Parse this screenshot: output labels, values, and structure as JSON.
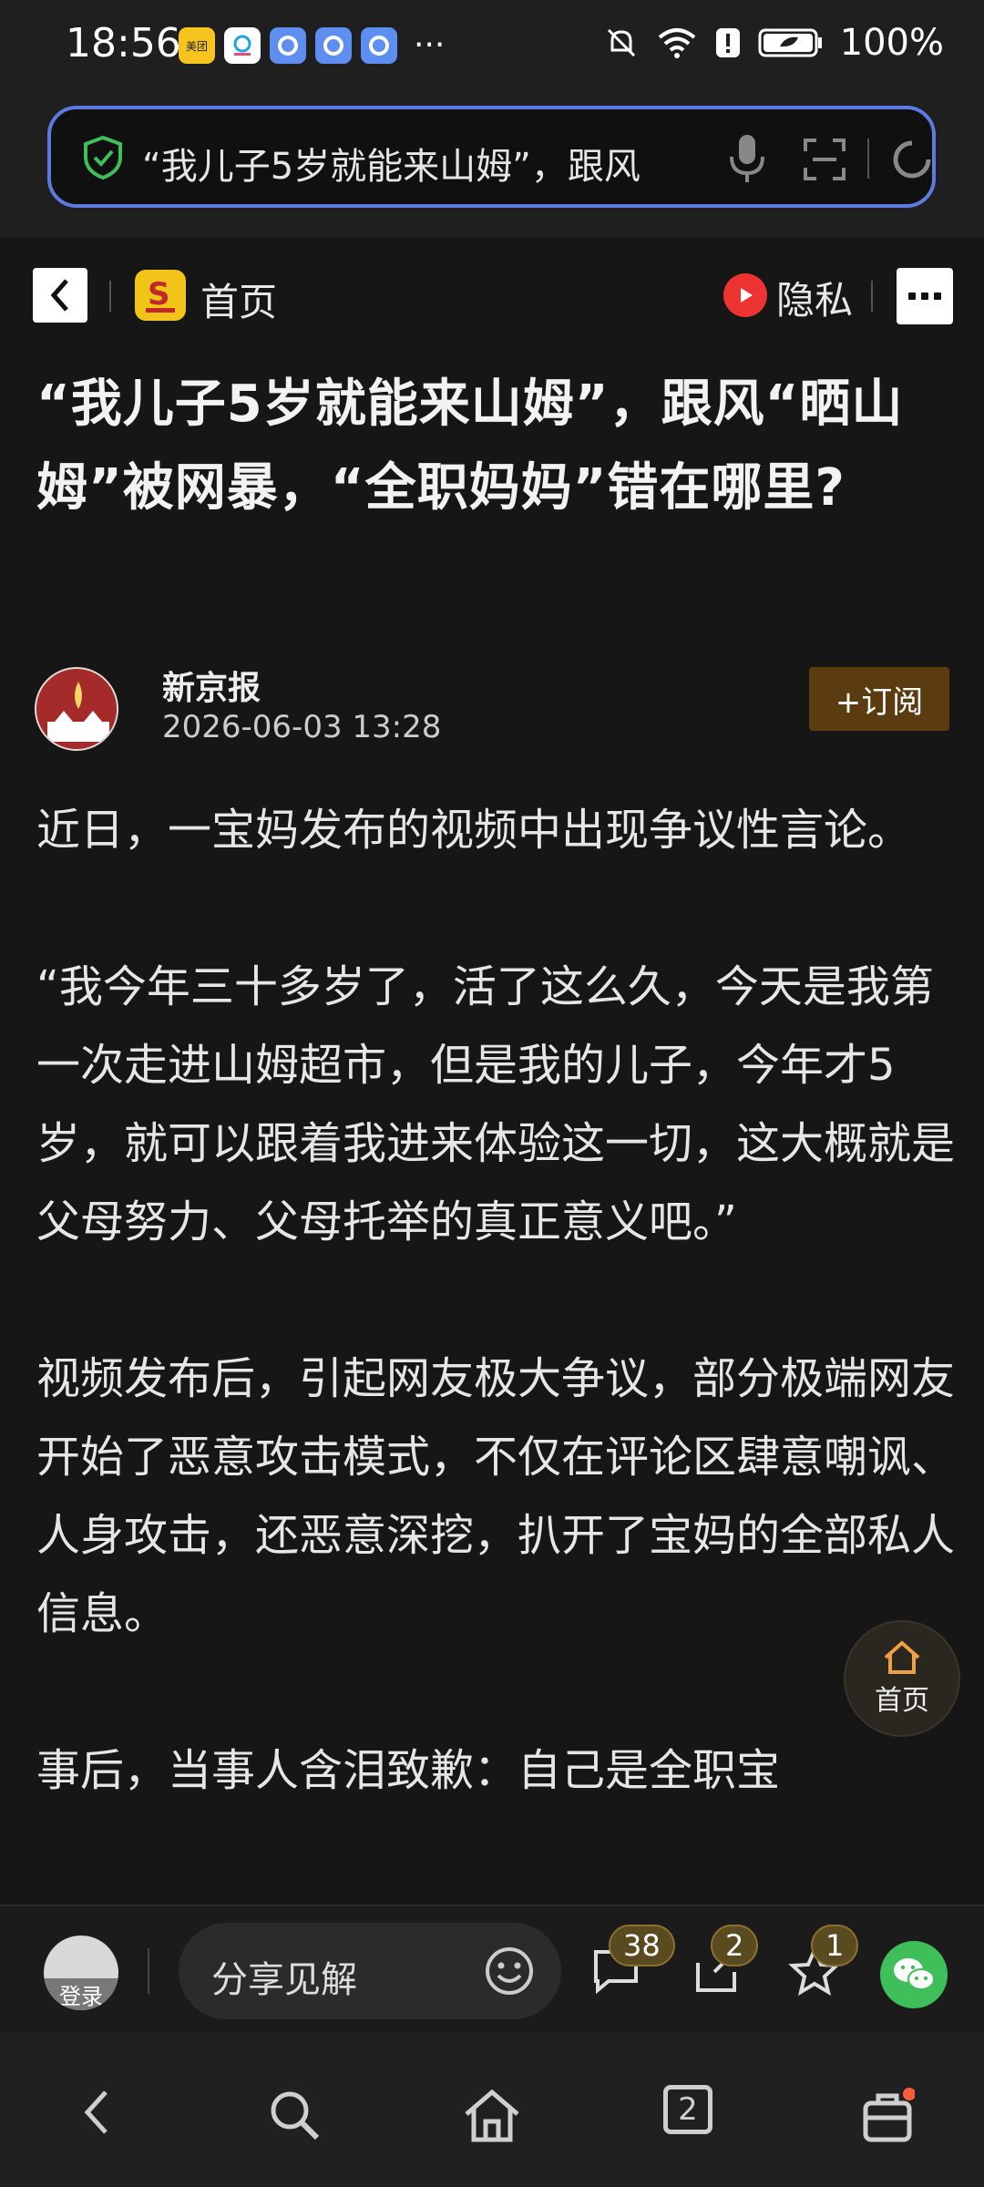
{
  "status_bar": {
    "time": "18:56",
    "apps": [
      "美团",
      "移动",
      "app",
      "app",
      "app"
    ],
    "more": "···",
    "battery": "100%"
  },
  "address_bar": {
    "url_text": "“我儿子5岁就能来山姆”，跟风",
    "icons": [
      "shield-check-icon",
      "microphone-icon",
      "scan-icon",
      "refresh-icon"
    ]
  },
  "top_nav": {
    "home_label": "首页",
    "privacy_label": "隐私"
  },
  "article": {
    "title": "“我儿子5岁就能来山姆”，跟风“晒山姆”被网暴，“全职妈妈”错在哪里?",
    "author_name": "新京报",
    "publish_time": "2026-06-03 13:28",
    "subscribe_label": "+订阅",
    "paragraphs": [
      "近日，一宝妈发布的视频中出现争议性言论。",
      "“我今年三十多岁了，活了这么久，今天是我第一次走进山姆超市，但是我的儿子，今年才5岁，就可以跟着我进来体验这一切，这大概就是父母努力、父母托举的真正意义吧。”",
      "视频发布后，引起网友极大争议，部分极端网友开始了恶意攻击模式，不仅在评论区肆意嘲讽、人身攻击，还恶意深挖，扒开了宝妈的全部私人信息。",
      "事后，当事人含泪致歉：自己是全职宝"
    ]
  },
  "floating_home": {
    "label": "首页"
  },
  "action_bar": {
    "login_label": "登录",
    "share_placeholder": "分享见解",
    "comment_count": "38",
    "share_count": "2",
    "favorite_count": "1"
  },
  "nav_bar": {
    "tab_count": "2"
  },
  "colors": {
    "background": "#161616",
    "url_border": "#5b7be0",
    "subscribe_bg": "#5a3c10",
    "badge_bg": "#5a4a20",
    "wechat_green": "#3fbf5a"
  }
}
